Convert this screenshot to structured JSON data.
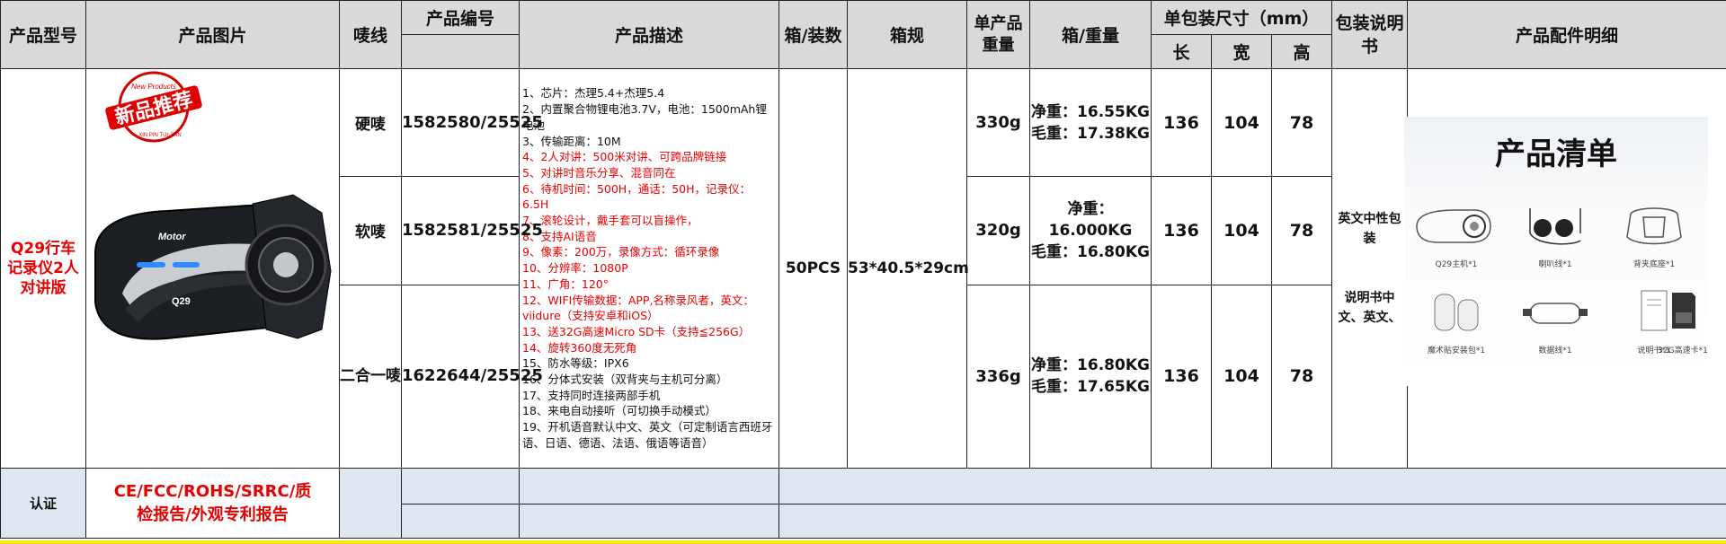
{
  "headers": {
    "model": "产品型号",
    "picture": "产品图片",
    "mount": "唛线",
    "code": "产品编号",
    "desc": "产品描述",
    "box_qty": "箱/装数",
    "box_spec": "箱规",
    "unit_weight": "单产品重量",
    "box_weight": "箱/重量",
    "pack_size": "单包装尺寸（mm）",
    "length": "长",
    "width": "宽",
    "height": "高",
    "manual": "包装说明书",
    "accessories": "产品配件明细"
  },
  "product": {
    "model": "Q29行车记录仪2人对讲版",
    "badge_main": "新品推荐",
    "badge_top": "New Products",
    "badge_bottom": "XIN PIN TUI JIAN",
    "device_brand": "Motor",
    "device_model": "Q29",
    "box_qty": "50PCS",
    "box_spec": "53*40.5*29cm",
    "manual": "英文中性包装",
    "manual_note": "说明书中文、英文、"
  },
  "variants": [
    {
      "mount": "硬唛",
      "code": "1582580/25525",
      "unit_weight": "330g",
      "net": "净重：16.55KG",
      "gross": "毛重：17.38KG",
      "l": "136",
      "w": "104",
      "h": "78"
    },
    {
      "mount": "软唛",
      "code": "1582581/25525",
      "unit_weight": "320g",
      "net": "净重：16.000KG",
      "gross": "毛重：16.80KG",
      "l": "136",
      "w": "104",
      "h": "78"
    },
    {
      "mount": "二合一唛",
      "code": "1622644/25525",
      "unit_weight": "336g",
      "net": "净重：16.80KG",
      "gross": "毛重：17.65KG",
      "l": "136",
      "w": "104",
      "h": "78"
    }
  ],
  "description": [
    {
      "text": "1、芯片：杰理5.4+杰理5.4",
      "color": "#111111"
    },
    {
      "text": "2、内置聚合物锂电池3.7V，电池：1500mAh锂电池",
      "color": "#111111"
    },
    {
      "text": "3、传输距离：10M",
      "color": "#111111"
    },
    {
      "text": "4、2人对讲：500米对讲、可跨品牌链接",
      "color": "#e60000"
    },
    {
      "text": "5、对讲时音乐分享、混音同在",
      "color": "#e60000"
    },
    {
      "text": "6、待机时间：500H，通话：50H，记录仪：6.5H",
      "color": "#e60000"
    },
    {
      "text": "7、滚轮设计，戴手套可以盲操作，",
      "color": "#e60000"
    },
    {
      "text": "8、支持AI语音",
      "color": "#e60000"
    },
    {
      "text": "9、像素：200万，录像方式：循环录像",
      "color": "#e60000"
    },
    {
      "text": "10、分辨率：1080P",
      "color": "#e60000"
    },
    {
      "text": "11、广角：120°",
      "color": "#e60000"
    },
    {
      "text": "12、WIFI传输数据：APP,名称录风者，英文：viidure（支持安卓和iOS）",
      "color": "#e60000"
    },
    {
      "text": "13、送32G高速Micro SD卡（支持≦256G）",
      "color": "#e60000"
    },
    {
      "text": "14、旋转360度无死角",
      "color": "#e60000"
    },
    {
      "text": "15、防水等级：IPX6",
      "color": "#111111"
    },
    {
      "text": "16、分体式安装（双背夹与主机可分离）",
      "color": "#111111"
    },
    {
      "text": "17、支持同时连接两部手机",
      "color": "#111111"
    },
    {
      "text": "18、来电自动接听（可切换手动模式）",
      "color": "#111111"
    },
    {
      "text": "19、开机语音默认中文、英文（可定制语言西班牙语、日语、德语、法语、俄语等语音）",
      "color": "#111111"
    }
  ],
  "accessories": {
    "title": "产品清单",
    "items": [
      {
        "label": "Q29主机*1",
        "icon": "helmet-device-icon"
      },
      {
        "label": "喇叭线*1",
        "icon": "speaker-cable-icon"
      },
      {
        "label": "背夹底座*1",
        "icon": "back-clip-icon"
      },
      {
        "label": "魔术贴安装包*1",
        "icon": "velcro-pads-icon"
      },
      {
        "label": "数据线*1",
        "icon": "usb-cable-icon"
      },
      {
        "label": "说明书*1",
        "icon": "manual-icon"
      },
      {
        "label": "32G高速卡*1",
        "icon": "sd-card-icon"
      }
    ]
  },
  "certification": {
    "label": "认证",
    "value": "CE/FCC/ROHS/SRRC/质检报告/外观专利报告"
  },
  "colors": {
    "header_bg": "#d9d9d9",
    "accent_red": "#e60000",
    "cert_bg": "#dfe8f2",
    "bottom_bar": "#ffe600"
  }
}
